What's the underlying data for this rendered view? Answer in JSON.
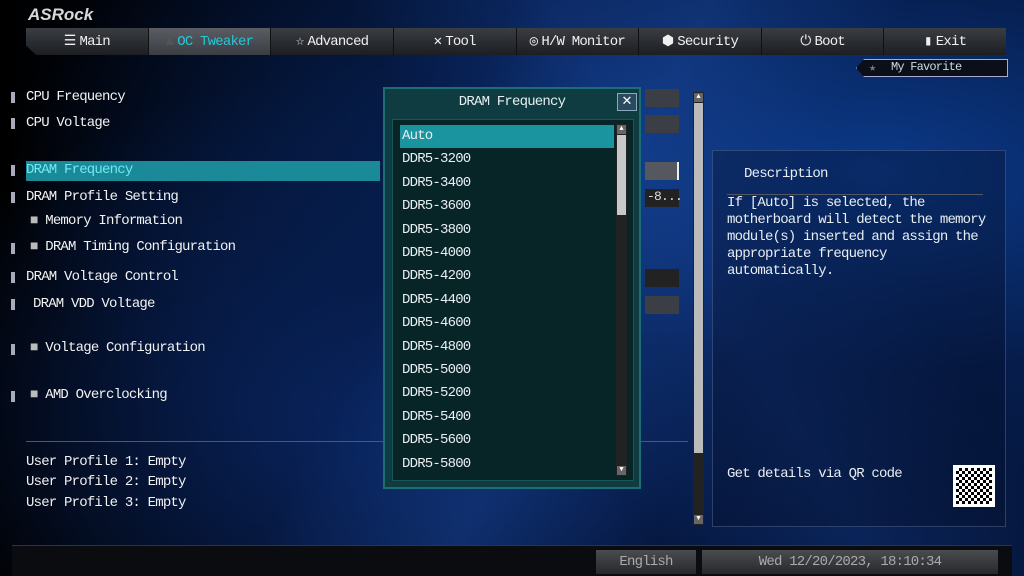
{
  "brand": "ASRock",
  "tabs": [
    {
      "label": "Main",
      "icon": "list-icon"
    },
    {
      "label": "OC Tweaker",
      "icon": "rocket-icon",
      "active": true
    },
    {
      "label": "Advanced",
      "icon": "star-icon"
    },
    {
      "label": "Tool",
      "icon": "tools-icon"
    },
    {
      "label": "H/W Monitor",
      "icon": "monitor-icon"
    },
    {
      "label": "Security",
      "icon": "shield-icon"
    },
    {
      "label": "Boot",
      "icon": "power-icon"
    },
    {
      "label": "Exit",
      "icon": "door-icon"
    }
  ],
  "favorite": "My Favorite",
  "settings": [
    "CPU Frequency",
    "CPU Voltage",
    "DRAM Frequency",
    "DRAM Profile Setting",
    "Memory Information",
    "DRAM Timing Configuration",
    "DRAM Voltage Control",
    "DRAM VDD Voltage",
    "Voltage Configuration",
    "AMD Overclocking"
  ],
  "profile_value_partial": "-8...",
  "profiles": [
    "User Profile 1: Empty",
    "User Profile 2: Empty",
    "User Profile 3: Empty"
  ],
  "popup": {
    "title": "DRAM Frequency",
    "options": [
      "Auto",
      "DDR5-3200",
      "DDR5-3400",
      "DDR5-3600",
      "DDR5-3800",
      "DDR5-4000",
      "DDR5-4200",
      "DDR5-4400",
      "DDR5-4600",
      "DDR5-4800",
      "DDR5-5000",
      "DDR5-5200",
      "DDR5-5400",
      "DDR5-5600",
      "DDR5-5800"
    ],
    "selected": "Auto"
  },
  "description": {
    "title": "Description",
    "text": "If [Auto] is selected, the motherboard will detect the memory module(s) inserted and assign the appropriate frequency automatically.",
    "qr_label": "Get details via QR code"
  },
  "status": {
    "language": "English",
    "datetime": "Wed 12/20/2023, 18:10:34"
  }
}
